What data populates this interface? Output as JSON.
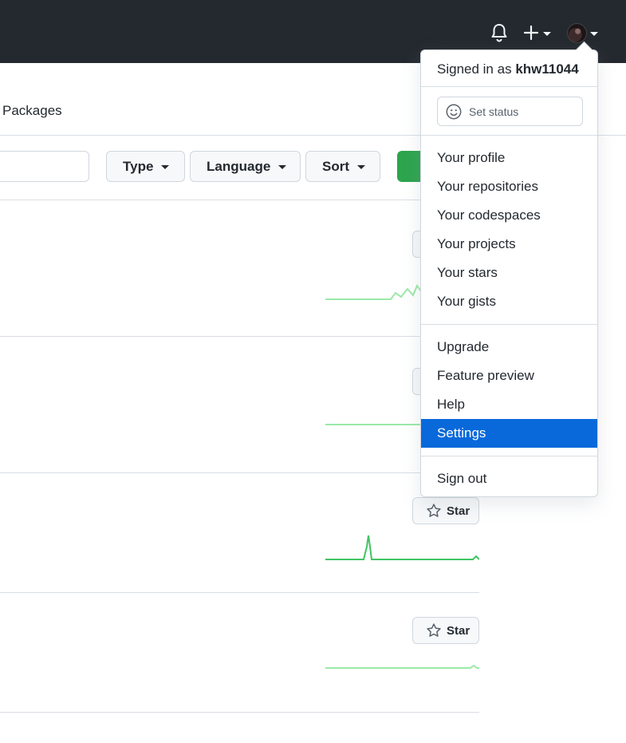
{
  "header": {
    "icons": [
      "bell-icon",
      "plus-icon",
      "avatar"
    ]
  },
  "tabs": {
    "packages_label": "Packages"
  },
  "filters": {
    "type_label": "Type",
    "language_label": "Language",
    "sort_label": "Sort"
  },
  "repos": {
    "star_label": "Star"
  },
  "menu": {
    "signed_in_prefix": "Signed in as",
    "username": "khw11044",
    "set_status_label": "Set status",
    "group1": [
      "Your profile",
      "Your repositories",
      "Your codespaces",
      "Your projects",
      "Your stars",
      "Your gists"
    ],
    "group2": [
      "Upgrade",
      "Feature preview",
      "Help",
      "Settings"
    ],
    "sign_out": "Sign out",
    "active_item": "Settings",
    "accent_color": "#0969da"
  }
}
